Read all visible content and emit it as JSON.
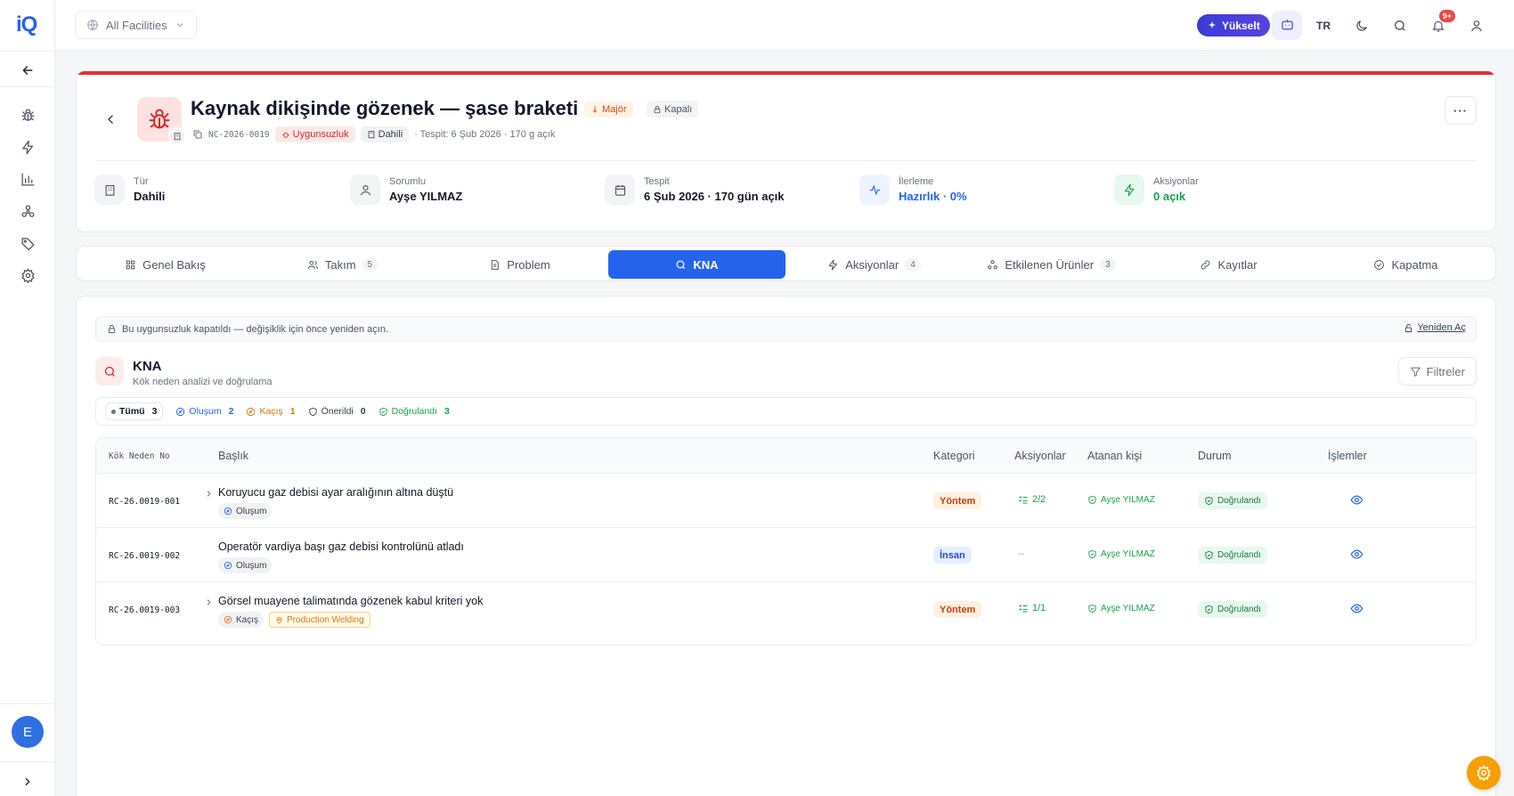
{
  "app": {
    "logo_text": "iQ"
  },
  "header": {
    "facility": "All Facilities",
    "upgrade_label": "Yükselt",
    "language": "TR",
    "notifications_badge": "9+"
  },
  "sidebar": {
    "icons": [
      "back-arrow-icon",
      "bug-icon",
      "bolt-icon",
      "bar-chart-icon",
      "network-icon",
      "tag-icon",
      "gear-icon"
    ],
    "avatar_initial": "E"
  },
  "record": {
    "title": "Kaynak dikişinde gözenek — şase braketi",
    "severity": "Majör",
    "state": "Kapalı",
    "code": "NC-2026-0019",
    "type_badge": "Uygunsuzluk",
    "origin_badge": "Dahili",
    "detected_text": "· Tespit: 6 Şub 2026 · 170 g açık",
    "more_label": "···"
  },
  "stats": [
    {
      "label": "Tür",
      "value": "Dahili"
    },
    {
      "label": "Sorumlu",
      "value": "Ayşe YILMAZ"
    },
    {
      "label": "Tespit",
      "value": "6 Şub 2026 · 170 gün açık"
    },
    {
      "label": "İlerleme",
      "value": "Hazırlık · 0%"
    },
    {
      "label": "Aksiyonlar",
      "value": "0 açık"
    }
  ],
  "tabs": [
    {
      "label": "Genel Bakış",
      "count": ""
    },
    {
      "label": "Takım",
      "count": "5"
    },
    {
      "label": "Problem",
      "count": ""
    },
    {
      "label": "KNA",
      "count": ""
    },
    {
      "label": "Aksiyonlar",
      "count": "4"
    },
    {
      "label": "Etkilenen Ürünler",
      "count": "3"
    },
    {
      "label": "Kayıtlar",
      "count": ""
    },
    {
      "label": "Kapatma",
      "count": ""
    }
  ],
  "active_tab": "KNA",
  "notice": {
    "text": "Bu uygunsuzluk kapatıldı — değişiklik için önce yeniden açın.",
    "reopen_label": "Yeniden Aç"
  },
  "section": {
    "title": "KNA",
    "subtitle": "Kök neden analizi ve doğrulama",
    "filter_label": "Filtreler"
  },
  "filters": [
    {
      "label": "Tümü",
      "count": "3"
    },
    {
      "label": "Oluşum",
      "count": "2"
    },
    {
      "label": "Kaçış",
      "count": "1"
    },
    {
      "label": "Önerildi",
      "count": "0"
    },
    {
      "label": "Doğrulandı",
      "count": "3"
    }
  ],
  "table": {
    "headers": [
      "Kök Neden No",
      "Başlık",
      "Kategori",
      "Aksiyonlar",
      "Atanan kişi",
      "Durum",
      "İşlemler"
    ],
    "rows": [
      {
        "id": "RC-26.0019-001",
        "title": "Koruyucu gaz debisi ayar aralığının altına düştü",
        "tag": "Oluşum",
        "location": "",
        "category": "Yöntem",
        "actions": "2/2",
        "assignee": "Ayşe YILMAZ",
        "status": "Doğrulandı"
      },
      {
        "id": "RC-26.0019-002",
        "title": "Operatör vardiya başı gaz debisi kontrolünü atladı",
        "tag": "Oluşum",
        "location": "",
        "category": "İnsan",
        "actions": "--",
        "assignee": "Ayşe YILMAZ",
        "status": "Doğrulandı"
      },
      {
        "id": "RC-26.0019-003",
        "title": "Görsel muayene talimatında gözenek kabul kriteri yok",
        "tag": "Kaçış",
        "location": "Production Welding",
        "category": "Yöntem",
        "actions": "1/1",
        "assignee": "Ayşe YILMAZ",
        "status": "Doğrulandı"
      }
    ]
  },
  "colors": {
    "accent": "#2563eb",
    "danger": "#e03131",
    "success": "#16a34a",
    "warning": "#f59f00"
  }
}
